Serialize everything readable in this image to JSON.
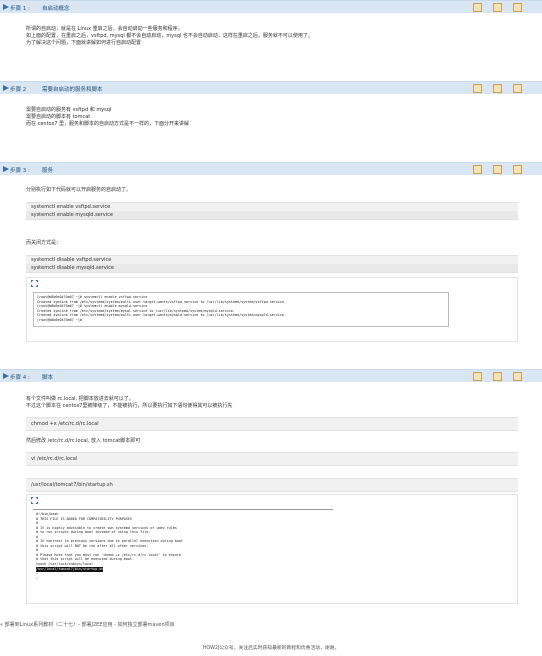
{
  "steps": [
    {
      "no": "步骤 1 :",
      "title": "自启动概念",
      "paragraphs": [
        "所谓的自启动，就是在 Linux 重启之后，会自动启动一些服务和程序。",
        "如上面的配置，在重启之后，vsftpd, mysql 都不会自动启动，mysql 也不会自动启动，这样在重启之后，服务就不可以使用了。",
        "为了解决这个问题，下面就讲解如何进行自启动配置"
      ]
    },
    {
      "no": "步骤 2",
      "title": "需要自启动的服务和脚本",
      "paragraphs": [
        "需要自启动的服务有 vsftpd 和 mysql",
        "需要自启动的脚本有 tomcat",
        "而在 centos7 里，服务和脚本的自启动方式是不一样的，下面分开来讲解"
      ]
    },
    {
      "no": "步骤 3 :",
      "title": "服务",
      "intro": "分别执行如下代码就可以开启服务的自启动了。",
      "enable_cmds": [
        "systemctl enable vsftpd.service",
        "systemctl enable mysqld.service"
      ],
      "close_label": "而关闭方式是：",
      "disable_cmds": [
        "systemctl disable vsftpd.service",
        "systemctl disable mysqld.service"
      ],
      "terminal": [
        "[root@b8b6e0470a67 ~]# systemctl enable vsftpd.service",
        "Created symlink from /etc/systemd/system/multi-user.target.wants/vsftpd.service to /usr/lib/systemd/system/vsftpd.service.",
        "[root@b8b6e0470a67 ~]# systemctl enable mysqld.service",
        "Created symlink from /etc/systemd/system/mysql.service to /usr/lib/systemd/system/mysqld.service.",
        "Created symlink from /etc/systemd/system/multi-user.target.wants/mysqld.service to /usr/lib/systemd/system/mysqld.service.",
        "[root@b8b6e0470a67 ~]# "
      ]
    },
    {
      "no": "步骤 4 :",
      "title": "脚本",
      "intro": [
        "有个文件叫做 rc.local, 把脚本放进去就可以了。",
        "不过这个脚本在 centos7里被降级了，不能被执行，所以要执行如下语句使得其可以被执行先"
      ],
      "cmd1": "chmod +x /etc/rc.d/rc.local",
      "mid_text": "然后修改 /etc/rc.d/rc.local, 放入 tomcat脚本即可",
      "cmd2": "vi /etc/rc.d/rc.local",
      "cmd3": "/usr/local/tomcat7/bin/startup.sh",
      "terminal": [
        "#!/bin/bash",
        "# THIS FILE IS ADDED FOR COMPATIBILITY PURPOSES",
        "#",
        "# It is highly advisable to create own systemd services or udev rules",
        "# to run scripts during boot instead of using this file.",
        "#",
        "# In contrast to previous versions due to parallel execution during boot",
        "# this script will NOT be run after all other services.",
        "#",
        "# Please note that you must run 'chmod +x /etc/rc.d/rc.local' to ensure",
        "# that this script will be executed during boot.",
        "",
        "touch /var/lock/subsys/local",
        "/usr/local/tomcat7/bin/startup.sh",
        "~",
        "~"
      ]
    }
  ],
  "footer": {
    "link": "« 部署到Linux系列教材（二十七）- 部署J2EE应用 - 如何独立部署maven项目",
    "note": "HOW2J公众号，关注后实时获知最新的教程和优惠活动，谢谢。"
  }
}
